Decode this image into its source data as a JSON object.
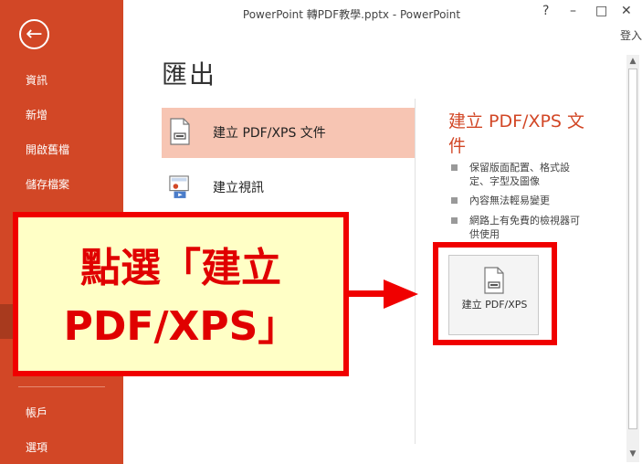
{
  "window": {
    "title": "PowerPoint 轉PDF教學.pptx - PowerPoint",
    "controls": [
      "?",
      "–",
      "□",
      "✕"
    ],
    "signin": "登入"
  },
  "sidebar": {
    "back_icon": "←",
    "items": [
      {
        "label": "資訊"
      },
      {
        "label": "新增"
      },
      {
        "label": "開啟舊檔"
      },
      {
        "label": "儲存檔案"
      }
    ],
    "bottom_items": [
      {
        "label": "帳戶"
      },
      {
        "label": "選項"
      }
    ],
    "accent_color": "#d24726"
  },
  "main": {
    "title": "匯出",
    "options": [
      {
        "label": "建立 PDF/XPS 文件",
        "selected": true,
        "icon": "pdf-document-icon"
      },
      {
        "label": "建立視訊",
        "selected": false,
        "icon": "video-icon"
      }
    ],
    "description": {
      "title": "建立 PDF/XPS 文件",
      "bullets": [
        "保留版面配置、格式設定、字型及圖像",
        "內容無法輕易變更",
        "網路上有免費的檢視器可供使用"
      ]
    },
    "action_button": {
      "label": "建立 PDF/XPS",
      "icon": "pdf-document-icon"
    }
  },
  "annotation": {
    "text_line1": "點選「建立",
    "text_line2": "PDF/XPS」",
    "color": "#f00000",
    "background": "#ffffc6"
  }
}
